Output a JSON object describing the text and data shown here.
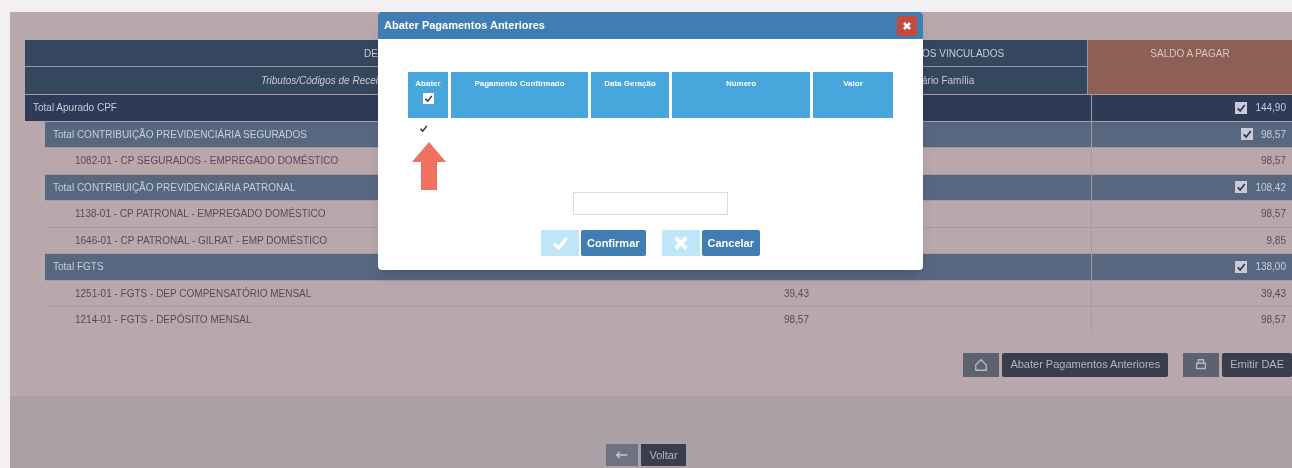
{
  "table": {
    "header_row_1": {
      "left": "DE",
      "right": "OS VINCULADOS",
      "saldo": "SALDO A PAGAR"
    },
    "header_row_2": {
      "left": "Tributos/Códigos de Recei",
      "right": "ário Família"
    },
    "rows": [
      {
        "kind": "grand_total",
        "label": "Total Apurado CPF",
        "saldo": "144,90",
        "checked": true
      },
      {
        "kind": "subtotal",
        "label": "Total CONTRIBUIÇÃO PREVIDENCIÁRIA SEGURADOS",
        "saldo": "98,57",
        "checked": true
      },
      {
        "kind": "item",
        "label": "1082-01 - CP SEGURADOS - EMPREGADO DOMÉSTICO",
        "saldo": "98,57"
      },
      {
        "kind": "subtotal",
        "label": "Total CONTRIBUIÇÃO PREVIDENCIÁRIA PATRONAL",
        "saldo": "108,42",
        "checked": true
      },
      {
        "kind": "item",
        "label": "1138-01 - CP PATRONAL - EMPREGADO DOMÉSTICO",
        "saldo": "98,57"
      },
      {
        "kind": "item",
        "label": "1646-01 - CP PATRONAL - GILRAT - EMP DOMÉSTICO",
        "saldo": "9,85"
      },
      {
        "kind": "subtotal",
        "label": "Total FGTS",
        "saldo": "138,00",
        "checked": true
      },
      {
        "kind": "item",
        "label": "1251-01 - FGTS - DEP COMPENSATÓRIO MENSAL",
        "value": "39,43",
        "saldo": "39,43"
      },
      {
        "kind": "item",
        "label": "1214-01 - FGTS - DEPÓSITO MENSAL",
        "value": "98,57",
        "saldo": "98,57"
      }
    ]
  },
  "actions": [
    {
      "kind": "abater",
      "label": "Abater Pagamentos Anteriores"
    },
    {
      "kind": "emitir",
      "label": "Emitir DAE"
    }
  ],
  "back_button": {
    "label": "Voltar"
  },
  "dialog": {
    "title": "Abater Pagamentos Anteriores",
    "columns": [
      "Abater",
      "Pagamento Confirmado",
      "Data Geração",
      "Número",
      "Valor"
    ],
    "select_all_checked": true,
    "rows": [
      {
        "checked": true
      }
    ],
    "buttons": [
      {
        "kind": "confirm",
        "label": "Confirmar"
      },
      {
        "kind": "cancel",
        "label": "Cancelar"
      }
    ]
  }
}
